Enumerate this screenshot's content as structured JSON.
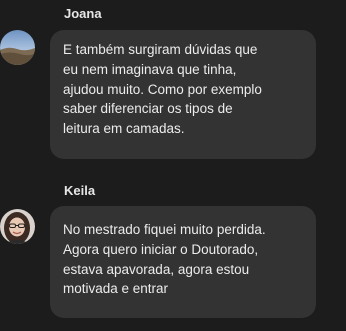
{
  "messages": [
    {
      "author": "Joana",
      "avatar": "landscape-avatar",
      "lines": [
        "E também surgiram dúvidas que",
        "eu nem imaginava que tinha,",
        "ajudou muito. Como por exemplo",
        "saber diferenciar os tipos de",
        "leitura em camadas."
      ]
    },
    {
      "author": "Keila",
      "avatar": "person-avatar",
      "lines": [
        "No mestrado fiquei muito perdida.",
        "Agora quero iniciar o Doutorado,",
        "estava apavorada, agora estou",
        "motivada e entrar"
      ]
    }
  ],
  "colors": {
    "background": "#1c1c1c",
    "bubble": "#333333",
    "text": "#ececec"
  }
}
